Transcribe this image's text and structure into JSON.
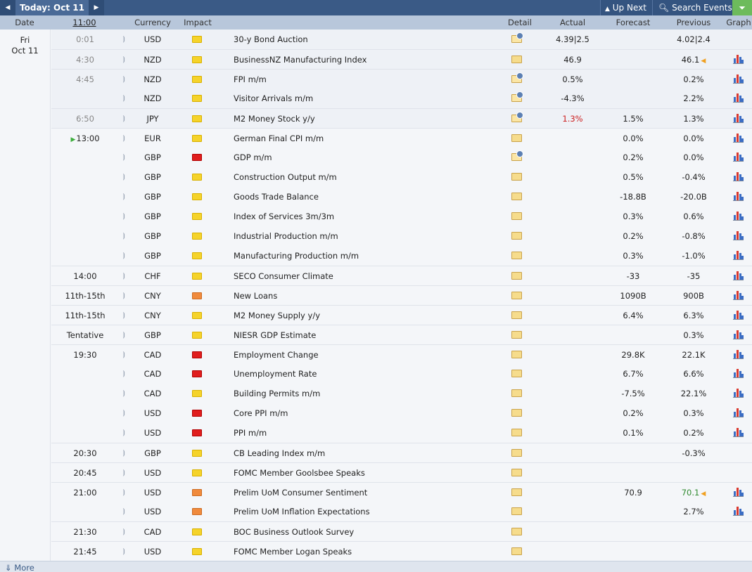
{
  "toolbar": {
    "today_label": "Today: Oct 11",
    "up_next_label": "Up Next",
    "search_label": "Search Events"
  },
  "header": {
    "date": "Date",
    "time": "11:00",
    "currency": "Currency",
    "impact": "Impact",
    "detail": "Detail",
    "actual": "Actual",
    "forecast": "Forecast",
    "previous": "Previous",
    "graph": "Graph"
  },
  "day": {
    "weekday": "Fri",
    "date": "Oct 11"
  },
  "events": [
    {
      "time": "0:01",
      "currency": "USD",
      "impact": "low",
      "event": "30-y Bond Auction",
      "detail": "open",
      "actual": "4.39|2.5",
      "actual_color": "",
      "forecast": "",
      "previous": "4.02|2.4",
      "previous_color": "",
      "previous_revised": false,
      "graph": false,
      "past": true,
      "group_start": true,
      "now": false
    },
    {
      "time": "4:30",
      "currency": "NZD",
      "impact": "low",
      "event": "BusinessNZ Manufacturing Index",
      "detail": "closed",
      "actual": "46.9",
      "actual_color": "",
      "forecast": "",
      "previous": "46.1",
      "previous_color": "",
      "previous_revised": true,
      "graph": true,
      "past": true,
      "group_start": true,
      "now": false
    },
    {
      "time": "4:45",
      "currency": "NZD",
      "impact": "low",
      "event": "FPI m/m",
      "detail": "open",
      "actual": "0.5%",
      "actual_color": "",
      "forecast": "",
      "previous": "0.2%",
      "previous_color": "",
      "previous_revised": false,
      "graph": true,
      "past": true,
      "group_start": true,
      "now": false
    },
    {
      "time": "",
      "currency": "NZD",
      "impact": "low",
      "event": "Visitor Arrivals m/m",
      "detail": "open",
      "actual": "-4.3%",
      "actual_color": "",
      "forecast": "",
      "previous": "2.2%",
      "previous_color": "",
      "previous_revised": false,
      "graph": true,
      "past": true,
      "group_start": false,
      "now": false
    },
    {
      "time": "6:50",
      "currency": "JPY",
      "impact": "low",
      "event": "M2 Money Stock y/y",
      "detail": "open",
      "actual": "1.3%",
      "actual_color": "red",
      "forecast": "1.5%",
      "previous": "1.3%",
      "previous_color": "",
      "previous_revised": false,
      "graph": true,
      "past": true,
      "group_start": true,
      "now": false
    },
    {
      "time": "13:00",
      "currency": "EUR",
      "impact": "low",
      "event": "German Final CPI m/m",
      "detail": "closed",
      "actual": "",
      "actual_color": "",
      "forecast": "0.0%",
      "previous": "0.0%",
      "previous_color": "",
      "previous_revised": false,
      "graph": true,
      "past": false,
      "group_start": true,
      "now": true
    },
    {
      "time": "",
      "currency": "GBP",
      "impact": "high",
      "event": "GDP m/m",
      "detail": "open",
      "actual": "",
      "actual_color": "",
      "forecast": "0.2%",
      "previous": "0.0%",
      "previous_color": "",
      "previous_revised": false,
      "graph": true,
      "past": false,
      "group_start": false,
      "now": false
    },
    {
      "time": "",
      "currency": "GBP",
      "impact": "low",
      "event": "Construction Output m/m",
      "detail": "closed",
      "actual": "",
      "actual_color": "",
      "forecast": "0.5%",
      "previous": "-0.4%",
      "previous_color": "",
      "previous_revised": false,
      "graph": true,
      "past": false,
      "group_start": false,
      "now": false
    },
    {
      "time": "",
      "currency": "GBP",
      "impact": "low",
      "event": "Goods Trade Balance",
      "detail": "closed",
      "actual": "",
      "actual_color": "",
      "forecast": "-18.8B",
      "previous": "-20.0B",
      "previous_color": "",
      "previous_revised": false,
      "graph": true,
      "past": false,
      "group_start": false,
      "now": false
    },
    {
      "time": "",
      "currency": "GBP",
      "impact": "low",
      "event": "Index of Services 3m/3m",
      "detail": "closed",
      "actual": "",
      "actual_color": "",
      "forecast": "0.3%",
      "previous": "0.6%",
      "previous_color": "",
      "previous_revised": false,
      "graph": true,
      "past": false,
      "group_start": false,
      "now": false
    },
    {
      "time": "",
      "currency": "GBP",
      "impact": "low",
      "event": "Industrial Production m/m",
      "detail": "closed",
      "actual": "",
      "actual_color": "",
      "forecast": "0.2%",
      "previous": "-0.8%",
      "previous_color": "",
      "previous_revised": false,
      "graph": true,
      "past": false,
      "group_start": false,
      "now": false
    },
    {
      "time": "",
      "currency": "GBP",
      "impact": "low",
      "event": "Manufacturing Production m/m",
      "detail": "closed",
      "actual": "",
      "actual_color": "",
      "forecast": "0.3%",
      "previous": "-1.0%",
      "previous_color": "",
      "previous_revised": false,
      "graph": true,
      "past": false,
      "group_start": false,
      "now": false
    },
    {
      "time": "14:00",
      "currency": "CHF",
      "impact": "low",
      "event": "SECO Consumer Climate",
      "detail": "closed",
      "actual": "",
      "actual_color": "",
      "forecast": "-33",
      "previous": "-35",
      "previous_color": "",
      "previous_revised": false,
      "graph": true,
      "past": false,
      "group_start": true,
      "now": false
    },
    {
      "time": "11th-15th",
      "currency": "CNY",
      "impact": "med",
      "event": "New Loans",
      "detail": "closed",
      "actual": "",
      "actual_color": "",
      "forecast": "1090B",
      "previous": "900B",
      "previous_color": "",
      "previous_revised": false,
      "graph": true,
      "past": false,
      "group_start": true,
      "now": false
    },
    {
      "time": "11th-15th",
      "currency": "CNY",
      "impact": "low",
      "event": "M2 Money Supply y/y",
      "detail": "closed",
      "actual": "",
      "actual_color": "",
      "forecast": "6.4%",
      "previous": "6.3%",
      "previous_color": "",
      "previous_revised": false,
      "graph": true,
      "past": false,
      "group_start": true,
      "now": false
    },
    {
      "time": "Tentative",
      "currency": "GBP",
      "impact": "low",
      "event": "NIESR GDP Estimate",
      "detail": "closed",
      "actual": "",
      "actual_color": "",
      "forecast": "",
      "previous": "0.3%",
      "previous_color": "",
      "previous_revised": false,
      "graph": true,
      "past": false,
      "group_start": true,
      "now": false
    },
    {
      "time": "19:30",
      "currency": "CAD",
      "impact": "high",
      "event": "Employment Change",
      "detail": "closed",
      "actual": "",
      "actual_color": "",
      "forecast": "29.8K",
      "previous": "22.1K",
      "previous_color": "",
      "previous_revised": false,
      "graph": true,
      "past": false,
      "group_start": true,
      "now": false
    },
    {
      "time": "",
      "currency": "CAD",
      "impact": "high",
      "event": "Unemployment Rate",
      "detail": "closed",
      "actual": "",
      "actual_color": "",
      "forecast": "6.7%",
      "previous": "6.6%",
      "previous_color": "",
      "previous_revised": false,
      "graph": true,
      "past": false,
      "group_start": false,
      "now": false
    },
    {
      "time": "",
      "currency": "CAD",
      "impact": "low",
      "event": "Building Permits m/m",
      "detail": "closed",
      "actual": "",
      "actual_color": "",
      "forecast": "-7.5%",
      "previous": "22.1%",
      "previous_color": "",
      "previous_revised": false,
      "graph": true,
      "past": false,
      "group_start": false,
      "now": false
    },
    {
      "time": "",
      "currency": "USD",
      "impact": "high",
      "event": "Core PPI m/m",
      "detail": "closed",
      "actual": "",
      "actual_color": "",
      "forecast": "0.2%",
      "previous": "0.3%",
      "previous_color": "",
      "previous_revised": false,
      "graph": true,
      "past": false,
      "group_start": false,
      "now": false
    },
    {
      "time": "",
      "currency": "USD",
      "impact": "high",
      "event": "PPI m/m",
      "detail": "closed",
      "actual": "",
      "actual_color": "",
      "forecast": "0.1%",
      "previous": "0.2%",
      "previous_color": "",
      "previous_revised": false,
      "graph": true,
      "past": false,
      "group_start": false,
      "now": false
    },
    {
      "time": "20:30",
      "currency": "GBP",
      "impact": "low",
      "event": "CB Leading Index m/m",
      "detail": "closed",
      "actual": "",
      "actual_color": "",
      "forecast": "",
      "previous": "-0.3%",
      "previous_color": "",
      "previous_revised": false,
      "graph": false,
      "past": false,
      "group_start": true,
      "now": false
    },
    {
      "time": "20:45",
      "currency": "USD",
      "impact": "low",
      "event": "FOMC Member Goolsbee Speaks",
      "detail": "closed",
      "actual": "",
      "actual_color": "",
      "forecast": "",
      "previous": "",
      "previous_color": "",
      "previous_revised": false,
      "graph": false,
      "past": false,
      "group_start": true,
      "now": false
    },
    {
      "time": "21:00",
      "currency": "USD",
      "impact": "med",
      "event": "Prelim UoM Consumer Sentiment",
      "detail": "closed",
      "actual": "",
      "actual_color": "",
      "forecast": "70.9",
      "previous": "70.1",
      "previous_color": "green",
      "previous_revised": true,
      "graph": true,
      "past": false,
      "group_start": true,
      "now": false
    },
    {
      "time": "",
      "currency": "USD",
      "impact": "med",
      "event": "Prelim UoM Inflation Expectations",
      "detail": "closed",
      "actual": "",
      "actual_color": "",
      "forecast": "",
      "previous": "2.7%",
      "previous_color": "",
      "previous_revised": false,
      "graph": true,
      "past": false,
      "group_start": false,
      "now": false
    },
    {
      "time": "21:30",
      "currency": "CAD",
      "impact": "low",
      "event": "BOC Business Outlook Survey",
      "detail": "closed",
      "actual": "",
      "actual_color": "",
      "forecast": "",
      "previous": "",
      "previous_color": "",
      "previous_revised": false,
      "graph": false,
      "past": false,
      "group_start": true,
      "now": false
    },
    {
      "time": "21:45",
      "currency": "USD",
      "impact": "low",
      "event": "FOMC Member Logan Speaks",
      "detail": "closed",
      "actual": "",
      "actual_color": "",
      "forecast": "",
      "previous": "",
      "previous_color": "",
      "previous_revised": false,
      "graph": false,
      "past": false,
      "group_start": true,
      "now": false
    }
  ],
  "footer": {
    "more_label": "More"
  },
  "colors": {
    "toolbar": "#3a5a86",
    "header": "#b8c7db",
    "better": "#2f8a2f",
    "worse": "#cc1f1f"
  },
  "icons": {
    "prev": "left-triangle",
    "next": "right-triangle",
    "up_next": "up-triangle",
    "search": "magnifier",
    "filter": "funnel",
    "more": "down-arrow"
  }
}
